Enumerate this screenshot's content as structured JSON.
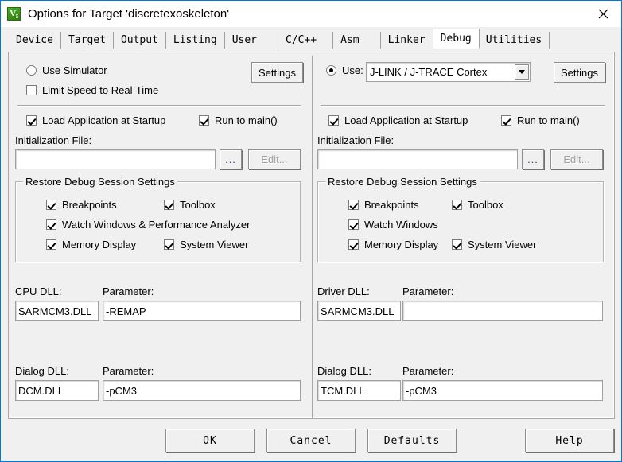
{
  "window": {
    "title": "Options for Target 'discretexoskeleton'",
    "app_icon": "uvision-v5-icon",
    "close_icon": "close-icon",
    "accent_color": "#0078d7"
  },
  "tabs": [
    {
      "label": "Device",
      "selected": false
    },
    {
      "label": "Target",
      "selected": false
    },
    {
      "label": "Output",
      "selected": false
    },
    {
      "label": "Listing",
      "selected": false
    },
    {
      "label": "User",
      "selected": false
    },
    {
      "label": "C/C++",
      "selected": false
    },
    {
      "label": "Asm",
      "selected": false
    },
    {
      "label": "Linker",
      "selected": false
    },
    {
      "label": "Debug",
      "selected": true
    },
    {
      "label": "Utilities",
      "selected": false
    }
  ],
  "left": {
    "use_simulator": {
      "label": "Use Simulator",
      "checked": false
    },
    "settings_button": "Settings",
    "limit_speed": {
      "label": "Limit Speed to Real-Time",
      "checked": false
    },
    "load_app": {
      "label": "Load Application at Startup",
      "checked": true
    },
    "run_to_main": {
      "label": "Run to main()",
      "checked": true
    },
    "init_file_label": "Initialization File:",
    "init_file_value": "",
    "browse_button": "...",
    "edit_button": "Edit...",
    "group": {
      "title": "Restore Debug Session Settings",
      "items": [
        {
          "label": "Breakpoints",
          "checked": true
        },
        {
          "label": "Toolbox",
          "checked": true
        },
        {
          "label": "Watch Windows & Performance Analyzer",
          "checked": true
        },
        {
          "label": "Memory Display",
          "checked": true
        },
        {
          "label": "System Viewer",
          "checked": true
        }
      ]
    },
    "cpu_dll_label": "CPU DLL:",
    "cpu_dll_value": "SARMCM3.DLL",
    "cpu_param_label": "Parameter:",
    "cpu_param_value": "-REMAP",
    "dialog_dll_label": "Dialog DLL:",
    "dialog_dll_value": "DCM.DLL",
    "dialog_param_label": "Parameter:",
    "dialog_param_value": "-pCM3"
  },
  "right": {
    "use_driver": {
      "label": "Use:",
      "checked": true
    },
    "driver_value": "J-LINK / J-TRACE Cortex",
    "settings_button": "Settings",
    "load_app": {
      "label": "Load Application at Startup",
      "checked": true
    },
    "run_to_main": {
      "label": "Run to main()",
      "checked": true
    },
    "init_file_label": "Initialization File:",
    "init_file_value": "",
    "browse_button": "...",
    "edit_button": "Edit...",
    "group": {
      "title": "Restore Debug Session Settings",
      "items": [
        {
          "label": "Breakpoints",
          "checked": true
        },
        {
          "label": "Toolbox",
          "checked": true
        },
        {
          "label": "Watch Windows",
          "checked": true
        },
        {
          "label": "Memory Display",
          "checked": true
        },
        {
          "label": "System Viewer",
          "checked": true
        }
      ]
    },
    "driver_dll_label": "Driver DLL:",
    "driver_dll_value": "SARMCM3.DLL",
    "driver_param_label": "Parameter:",
    "driver_param_value": "",
    "dialog_dll_label": "Dialog DLL:",
    "dialog_dll_value": "TCM.DLL",
    "dialog_param_label": "Parameter:",
    "dialog_param_value": "-pCM3"
  },
  "footer": {
    "ok": "OK",
    "cancel": "Cancel",
    "defaults": "Defaults",
    "help": "Help"
  }
}
